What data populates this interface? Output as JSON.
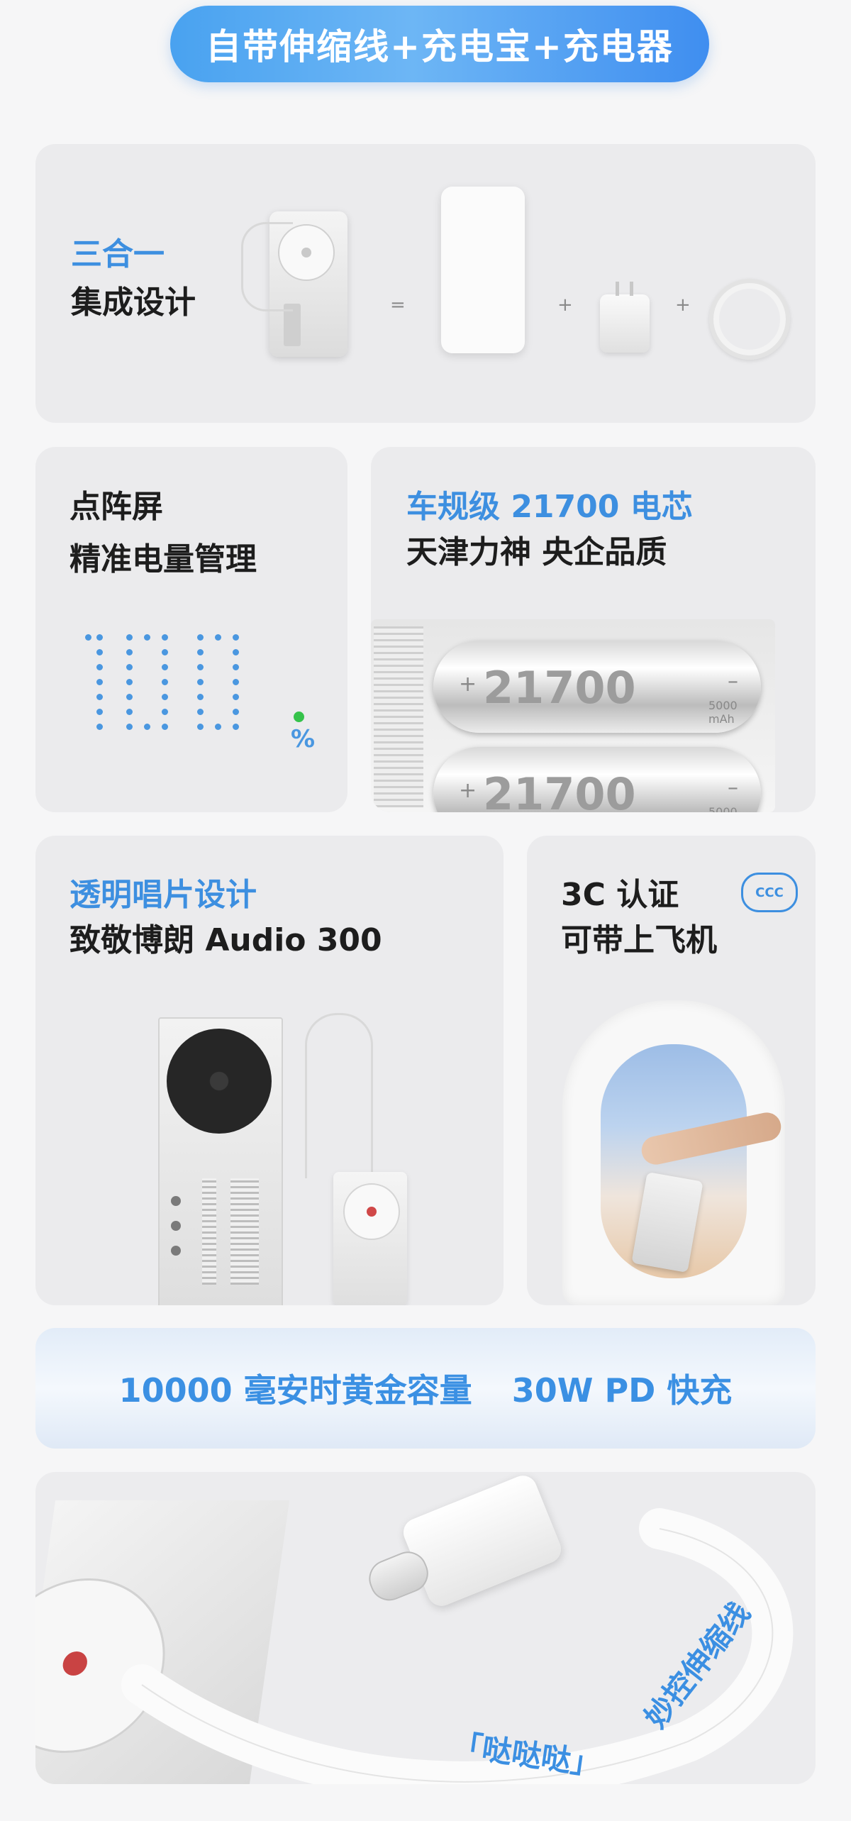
{
  "header": {
    "title": "自带伸缩线+充电宝+充电器"
  },
  "integrated": {
    "line1": "三合一",
    "line2": "集成设计",
    "eq": "=",
    "plus1": "+",
    "plus2": "+"
  },
  "display": {
    "line1": "点阵屏",
    "line2": "精准电量管理",
    "readout": "100",
    "percent": "%"
  },
  "battery": {
    "line1": "车规级 21700 电芯",
    "line2": "天津力神 央企品质",
    "cell_label": "21700",
    "cell_capacity": "5000 mAh",
    "plus": "+",
    "minus": "–"
  },
  "vinyl": {
    "line1": "透明唱片设计",
    "line2": "致敬博朗 Audio 300"
  },
  "cert": {
    "line1": "3C 认证",
    "line2": "可带上飞机",
    "badge": "CCC"
  },
  "specs": {
    "capacity": "10000 毫安时黄金容量",
    "charging": "30W PD 快充"
  },
  "cable": {
    "slogan_quote": "「哒哒哒」",
    "slogan": "妙控伸缩线"
  },
  "colors": {
    "accent": "#3d8fe0",
    "card": "#ebebed",
    "green_dot": "#35c24a"
  }
}
